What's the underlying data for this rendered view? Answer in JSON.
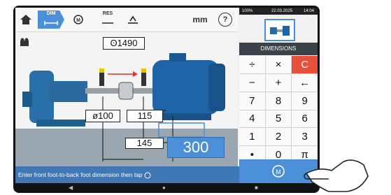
{
  "toolbar": {
    "home_icon": "home-icon",
    "dim_label": "DIM",
    "measure_icon": "measure-icon",
    "res_label": "RES",
    "move_icon": "move-icon",
    "unit_label": "mm",
    "help_label": "?"
  },
  "status_bar": {
    "battery": "100%",
    "date": "22.03.2025",
    "time": "14:04"
  },
  "dimensions": {
    "rpm_label": "ʘ1490",
    "coupling_diameter": "ø100",
    "sensor_distance": "115",
    "sensor_to_front_foot": "145",
    "front_to_back_foot_value": "300"
  },
  "panel": {
    "title": "DIMENSIONS",
    "keys": [
      "÷",
      "×",
      "C",
      "−",
      "+",
      "←",
      "7",
      "8",
      "9",
      "4",
      "5",
      "6",
      "1",
      "2",
      "3",
      "•",
      "0",
      "π"
    ]
  },
  "footer": {
    "instruction": "Enter front foot-to-back foot dimension then tap"
  },
  "colors": {
    "accent": "#4a8fd8",
    "clear_key": "#e8503a",
    "header": "#3a4149"
  }
}
